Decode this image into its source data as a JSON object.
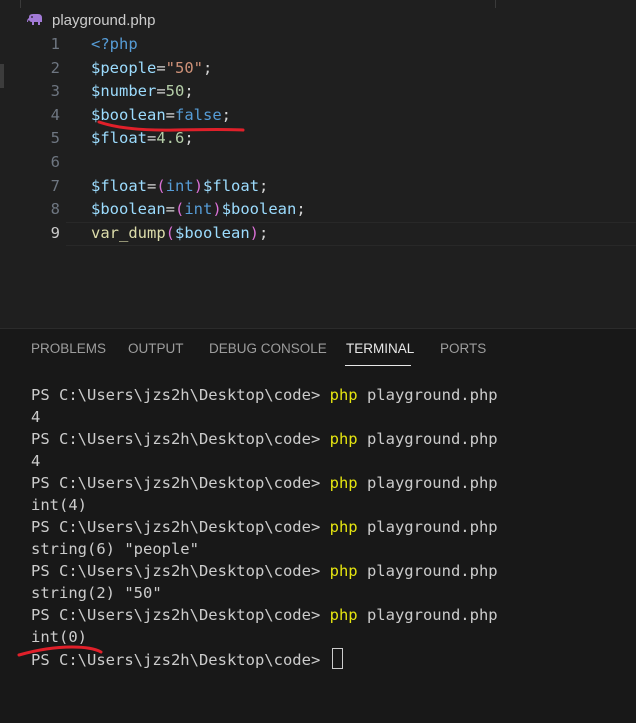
{
  "tab": {
    "filename": "playground.php",
    "icon": "elephant-icon"
  },
  "editor": {
    "active_line": 9,
    "lines": [
      {
        "num": "1",
        "tokens": [
          [
            "kw",
            "<?php"
          ]
        ]
      },
      {
        "num": "2",
        "tokens": [
          [
            "var",
            "$people"
          ],
          [
            "pl",
            "="
          ],
          [
            "str",
            "\"50\""
          ],
          [
            "pl",
            ";"
          ]
        ]
      },
      {
        "num": "3",
        "tokens": [
          [
            "var",
            "$number"
          ],
          [
            "pl",
            "="
          ],
          [
            "num",
            "50"
          ],
          [
            "pl",
            ";"
          ]
        ]
      },
      {
        "num": "4",
        "tokens": [
          [
            "var",
            "$boolean"
          ],
          [
            "pl",
            "="
          ],
          [
            "kw",
            "false"
          ],
          [
            "pl",
            ";"
          ]
        ]
      },
      {
        "num": "5",
        "tokens": [
          [
            "var",
            "$float"
          ],
          [
            "pl",
            "="
          ],
          [
            "num",
            "4.6"
          ],
          [
            "pl",
            ";"
          ]
        ]
      },
      {
        "num": "6",
        "tokens": []
      },
      {
        "num": "7",
        "tokens": [
          [
            "var",
            "$float"
          ],
          [
            "pl",
            "="
          ],
          [
            "par",
            "("
          ],
          [
            "kw",
            "int"
          ],
          [
            "par",
            ")"
          ],
          [
            "var",
            "$float"
          ],
          [
            "pl",
            ";"
          ]
        ]
      },
      {
        "num": "8",
        "tokens": [
          [
            "var",
            "$boolean"
          ],
          [
            "pl",
            "="
          ],
          [
            "par",
            "("
          ],
          [
            "kw",
            "int"
          ],
          [
            "par",
            ")"
          ],
          [
            "var",
            "$boolean"
          ],
          [
            "pl",
            ";"
          ]
        ]
      },
      {
        "num": "9",
        "tokens": [
          [
            "fn",
            "var_dump"
          ],
          [
            "par",
            "("
          ],
          [
            "var",
            "$boolean"
          ],
          [
            "par",
            ")"
          ],
          [
            "pl",
            ";"
          ]
        ]
      }
    ]
  },
  "panel": {
    "tabs": [
      "PROBLEMS",
      "OUTPUT",
      "DEBUG CONSOLE",
      "TERMINAL",
      "PORTS"
    ],
    "active_tab": "TERMINAL"
  },
  "terminal": {
    "prompt": "PS C:\\Users\\jzs2h\\Desktop\\code> ",
    "command": "php",
    "args": " playground.php",
    "lines": [
      {
        "type": "cmd"
      },
      {
        "type": "out",
        "text": "4"
      },
      {
        "type": "cmd"
      },
      {
        "type": "out",
        "text": "4"
      },
      {
        "type": "cmd"
      },
      {
        "type": "out",
        "text": "int(4)"
      },
      {
        "type": "cmd"
      },
      {
        "type": "out",
        "text": "string(6) \"people\""
      },
      {
        "type": "cmd"
      },
      {
        "type": "out",
        "text": "string(2) \"50\""
      },
      {
        "type": "cmd"
      },
      {
        "type": "out",
        "text": "int(0)"
      },
      {
        "type": "prompt"
      }
    ]
  },
  "colors": {
    "underline_annotation": "#e0202a",
    "terminal_command": "#e5e510",
    "variable": "#9cdcfe",
    "keyword": "#569cd6"
  }
}
